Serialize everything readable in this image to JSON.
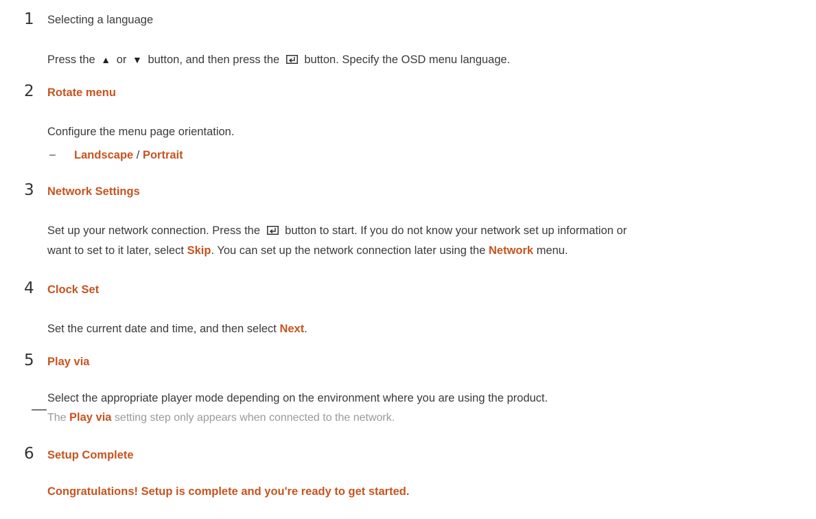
{
  "step1": {
    "num": "1",
    "title": "Selecting a language",
    "text_a": "Press the ",
    "text_or": " or ",
    "text_b": " button, and then press the ",
    "text_c": " button. Specify the OSD menu language."
  },
  "step2": {
    "num": "2",
    "title": "Rotate menu",
    "text": "Configure the menu page orientation.",
    "dash": "–",
    "opt1": "Landscape",
    "sep": " / ",
    "opt2": "Portrait"
  },
  "step3": {
    "num": "3",
    "title": "Network Settings",
    "line1_a": "Set up your network connection. Press the ",
    "line1_b": " button to start. If you do not know your network set up information or",
    "line2_a": "want to set to it later, select ",
    "skip": "Skip",
    "line2_b": ". You can set up the network connection later using the ",
    "network": "Network",
    "line2_c": " menu."
  },
  "step4": {
    "num": "4",
    "title": "Clock Set",
    "text_a": "Set the current date and time, and then select ",
    "next": "Next",
    "text_b": "."
  },
  "step5": {
    "num": "5",
    "title": "Play via",
    "text": "Select the appropriate player mode depending on the environment where you are using the product.",
    "note_a": "The ",
    "note_b": "Play via",
    "note_c": " setting step only appears when connected to the network."
  },
  "step6": {
    "num": "6",
    "title": "Setup Complete",
    "text": "Congratulations! Setup is complete and you're ready to get started."
  },
  "colors": {
    "accent": "#c6541f",
    "text": "#3a3a3a",
    "note": "#999999"
  },
  "icons": [
    "up-triangle-icon",
    "down-triangle-icon",
    "enter-icon"
  ]
}
